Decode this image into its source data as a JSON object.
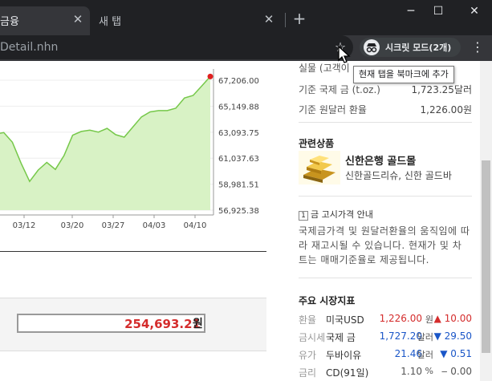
{
  "browser": {
    "active_tab_title": "금융",
    "inactive_tab_title": "새 탭",
    "tab_close_glyph": "✕",
    "new_tab_glyph": "+",
    "minimize_glyph": "─",
    "maximize_glyph": "☐",
    "close_glyph": "✕",
    "url_text": "Detail.nhn",
    "star_glyph": "☆",
    "incognito_label": "시크릿 모드(2개)",
    "menu_glyph": "⋮",
    "tooltip": "현재 탭을 북마크에 추가"
  },
  "chart_data": {
    "type": "area",
    "x_labels": [
      "03/12",
      "03/20",
      "03/27",
      "04/03",
      "04/10"
    ],
    "y_ticks": [
      "67,206.00",
      "65,149.88",
      "63,093.75",
      "61,037.63",
      "58,981.51",
      "56,925.38"
    ],
    "ylim": [
      56925.38,
      67206.0
    ],
    "values": [
      62950,
      63060,
      62300,
      60650,
      59200,
      60100,
      60700,
      60150,
      61250,
      62850,
      63150,
      63250,
      63100,
      63400,
      62900,
      62700,
      63500,
      64300,
      64700,
      64800,
      64800,
      65000,
      65800,
      66000,
      66750,
      67500
    ],
    "line_color": "#76c84a",
    "fill_color": "#d8f2c5",
    "marker_color": "#e02020"
  },
  "calculator": {
    "result": "254,693.21",
    "unit": "원"
  },
  "price_info": {
    "row1_label": "실물 (고객이",
    "row1_value": "",
    "row2_label": "기준 국제 금 (t.oz.)",
    "row2_value": "1,723.25달러",
    "row3_label": "기준 원달러 환율",
    "row3_value": "1,226.00원"
  },
  "related": {
    "title": "관련상품",
    "name": "신한은행 골드몰",
    "desc": "신한골드리슈, 신한 골드바"
  },
  "notice": {
    "num": "1",
    "title": "금 고시가격 안내",
    "body": "국제금가격 및 원달러환율의 움직임에 따라 재고시될 수 있습니다. 현재가 및 차트는 매매기준율로 제공됩니다."
  },
  "indicators": {
    "title": "주요 시장지표",
    "rows": [
      {
        "cat": "환율",
        "name": "미국USD",
        "value": "1,226.00",
        "unit": "원",
        "arrow": "▲",
        "change": "10.00",
        "dir": "up"
      },
      {
        "cat": "금시세",
        "name": "국제 금",
        "value": "1,727.20",
        "unit": "달러",
        "arrow": "▼",
        "change": "29.50",
        "dir": "down"
      },
      {
        "cat": "유가",
        "name": "두바이유",
        "value": "21.46",
        "unit": "달러",
        "arrow": "▼",
        "change": "0.51",
        "dir": "down"
      },
      {
        "cat": "금리",
        "name": "CD(91일)",
        "value": "1.10",
        "unit": "%",
        "arrow": "‒",
        "change": "0.00",
        "dir": "flat"
      }
    ]
  }
}
